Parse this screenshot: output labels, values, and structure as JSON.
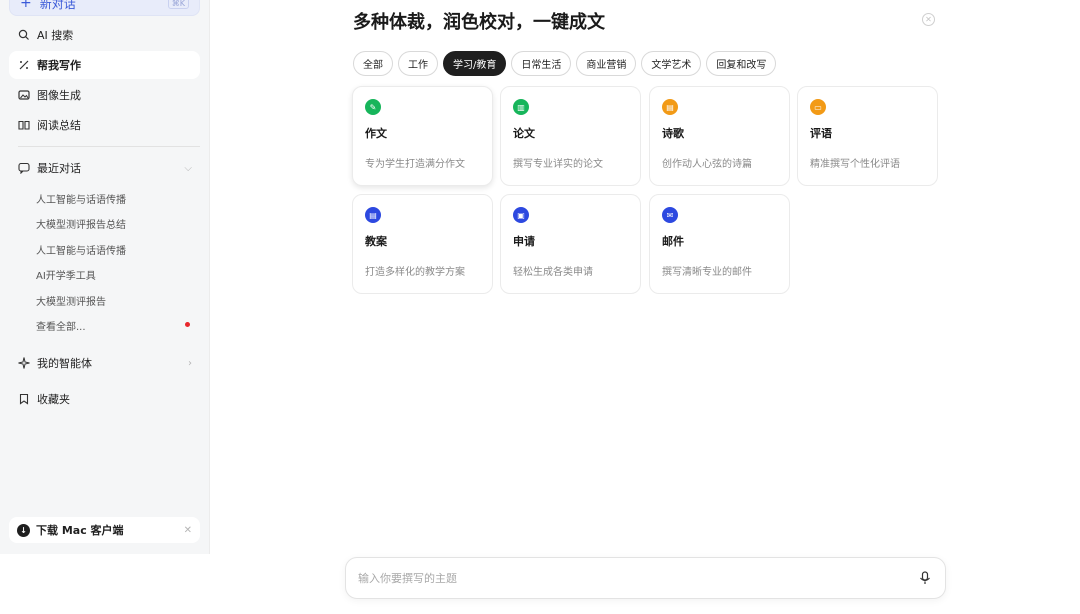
{
  "sidebar": {
    "new_chat": {
      "label": "新对话",
      "shortcut": "⌘K"
    },
    "nav": [
      {
        "label": "AI 搜索",
        "icon": "search-icon"
      },
      {
        "label": "帮我写作",
        "icon": "pen-icon",
        "active": true
      },
      {
        "label": "图像生成",
        "icon": "image-icon"
      },
      {
        "label": "阅读总结",
        "icon": "book-icon"
      }
    ],
    "recent": {
      "label": "最近对话",
      "items": [
        "人工智能与话语传播",
        "大模型测评报告总结",
        "人工智能与话语传播",
        "AI开学季工具",
        "大模型测评报告"
      ],
      "view_all": "查看全部..."
    },
    "agents_label": "我的智能体",
    "favorites_label": "收藏夹",
    "download_label": "下载 Mac 客户端"
  },
  "main": {
    "title": "多种体裁，润色校对，一键成文",
    "tabs": [
      "全部",
      "工作",
      "学习/教育",
      "日常生活",
      "商业营销",
      "文学艺术",
      "回复和改写"
    ],
    "active_tab": "学习/教育",
    "cards": [
      {
        "name": "作文",
        "desc": "专为学生打造满分作文",
        "icon": "pencil-icon",
        "color": "#17b55b"
      },
      {
        "name": "论文",
        "desc": "撰写专业详实的论文",
        "icon": "chart-doc-icon",
        "color": "#17b55b"
      },
      {
        "name": "诗歌",
        "desc": "创作动人心弦的诗篇",
        "icon": "poem-icon",
        "color": "#f29a16"
      },
      {
        "name": "评语",
        "desc": "精准撰写个性化评语",
        "icon": "comment-icon",
        "color": "#f29a16"
      },
      {
        "name": "教案",
        "desc": "打造多样化的教学方案",
        "icon": "lesson-plan-icon",
        "color": "#2d49e0"
      },
      {
        "name": "申请",
        "desc": "轻松生成各类申请",
        "icon": "clipboard-icon",
        "color": "#2d49e0"
      },
      {
        "name": "邮件",
        "desc": "撰写清晰专业的邮件",
        "icon": "mail-icon",
        "color": "#2d49e0"
      }
    ],
    "input_placeholder": "输入你要撰写的主题"
  }
}
